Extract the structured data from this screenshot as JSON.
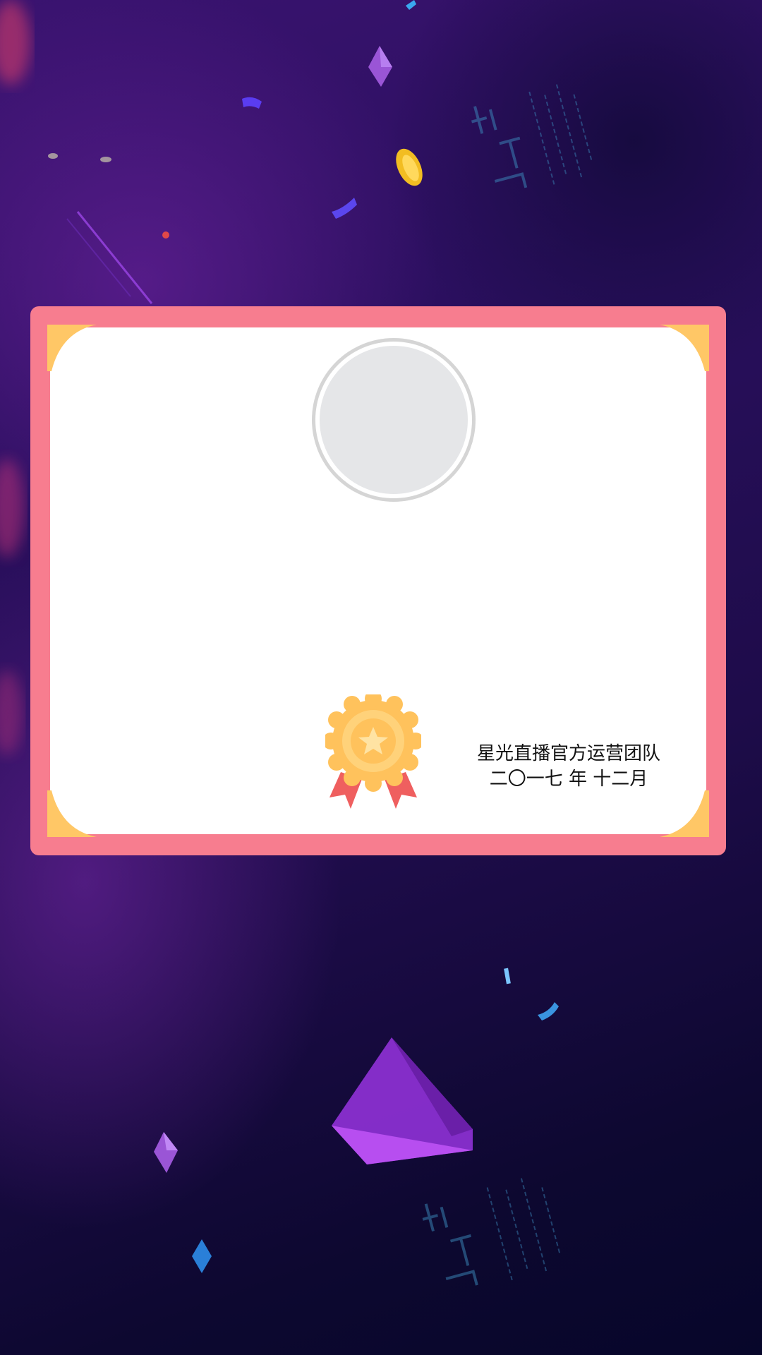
{
  "certificate": {
    "issuer": "星光直播官方运营团队",
    "date": "二〇一七 年 十二月"
  },
  "icons": {
    "avatar": "avatar-placeholder",
    "medal": "award-medal-icon"
  },
  "colors": {
    "frame": "#f77d8f",
    "corner": "#ffc766",
    "paper": "#ffffff",
    "avatar_fill": "#e5e6e8",
    "medal_gold": "#ffc25c",
    "ribbon": "#ef5f5f",
    "bg_purple": "#3a1370",
    "bg_dark": "#07062a"
  }
}
